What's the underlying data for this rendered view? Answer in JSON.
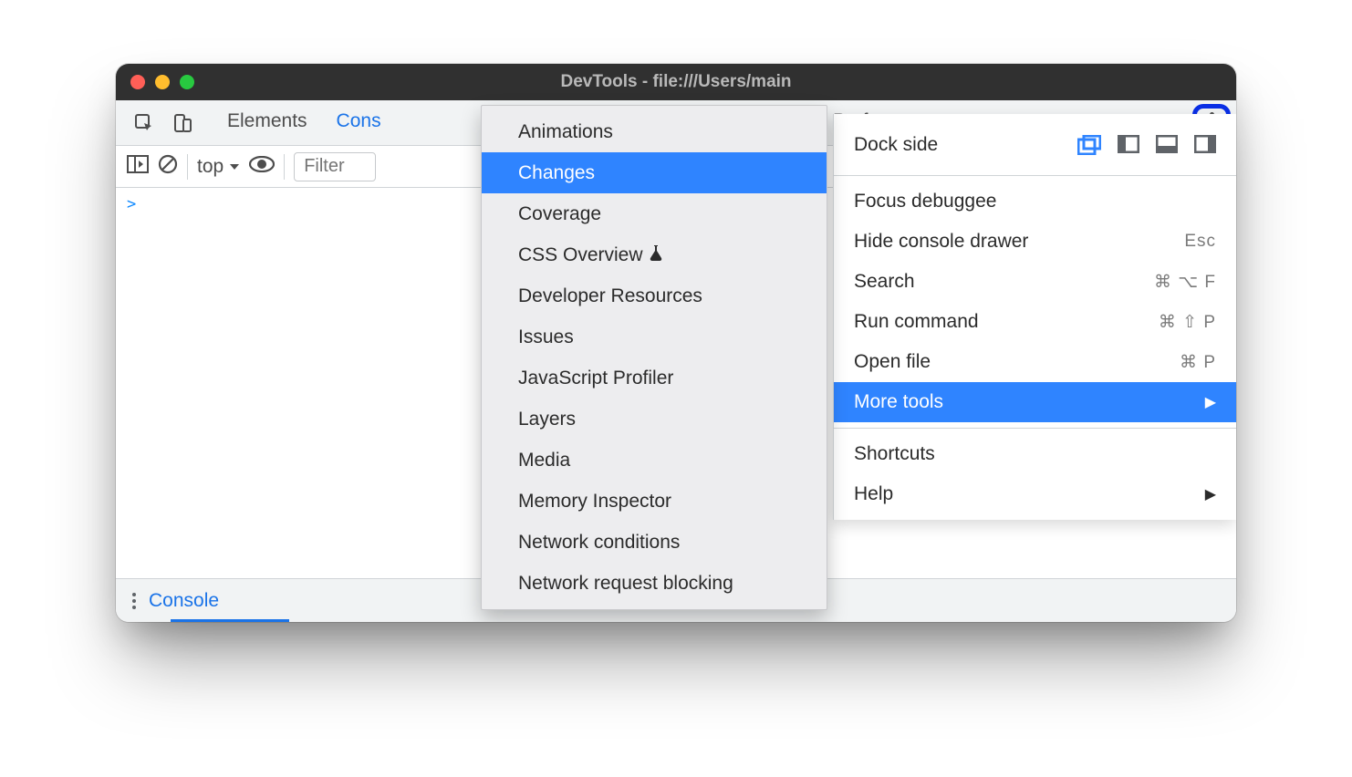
{
  "window": {
    "title": "DevTools - file:///Users/main"
  },
  "tabs": {
    "elements": "Elements",
    "console": "Cons",
    "performance": "Performance"
  },
  "toolbar": {
    "context": "top",
    "filter_placeholder": "Filter"
  },
  "console": {
    "prompt_glyph": ">"
  },
  "drawer": {
    "console_label": "Console"
  },
  "menu": {
    "dock_label": "Dock side",
    "focus": "Focus debuggee",
    "hide_drawer": {
      "label": "Hide console drawer",
      "shortcut": "Esc"
    },
    "search": {
      "label": "Search",
      "shortcut": "⌘ ⌥ F"
    },
    "run_command": {
      "label": "Run command",
      "shortcut": "⌘ ⇧ P"
    },
    "open_file": {
      "label": "Open file",
      "shortcut": "⌘ P"
    },
    "more_tools": "More tools",
    "shortcuts": "Shortcuts",
    "help": "Help"
  },
  "submenu": {
    "items": [
      "Animations",
      "Changes",
      "Coverage",
      "CSS Overview",
      "Developer Resources",
      "Issues",
      "JavaScript Profiler",
      "Layers",
      "Media",
      "Memory Inspector",
      "Network conditions",
      "Network request blocking"
    ],
    "highlighted_index": 1,
    "experimental_index": 3
  }
}
